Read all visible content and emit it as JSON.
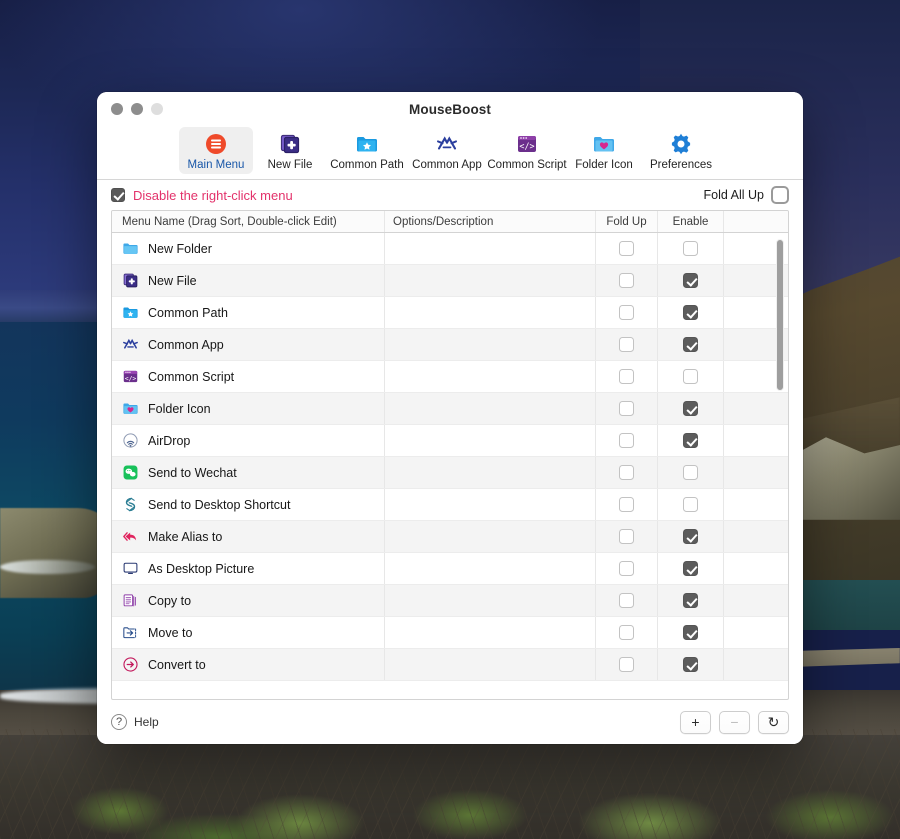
{
  "window": {
    "title": "MouseBoost",
    "traffic_lights": [
      "close-button",
      "minimize-button",
      "zoom-button"
    ]
  },
  "toolbar": {
    "items": [
      {
        "label": "Main Menu",
        "icon": "main-menu-icon",
        "selected": true
      },
      {
        "label": "New File",
        "icon": "new-file-icon",
        "selected": false
      },
      {
        "label": "Common Path",
        "icon": "common-path-icon",
        "selected": false
      },
      {
        "label": "Common App",
        "icon": "common-app-icon",
        "selected": false
      },
      {
        "label": "Common Script",
        "icon": "common-script-icon",
        "selected": false
      },
      {
        "label": "Folder Icon",
        "icon": "folder-icon-icon",
        "selected": false
      },
      {
        "label": "Preferences",
        "icon": "gear-icon",
        "selected": false
      }
    ]
  },
  "options_bar": {
    "disable_label": "Disable the right-click menu",
    "disable_checked": true,
    "disable_color": "#e3326b",
    "fold_all_label": "Fold All Up",
    "fold_all_checked": false
  },
  "table": {
    "headers": {
      "name": "Menu Name (Drag Sort, Double-click Edit)",
      "options": "Options/Description",
      "fold": "Fold Up",
      "enable": "Enable",
      "extra": ""
    },
    "rows": [
      {
        "name": "New Folder",
        "icon": "folder-plain-icon",
        "options": "",
        "fold": false,
        "enable": false
      },
      {
        "name": "New File",
        "icon": "new-file-icon",
        "options": "",
        "fold": false,
        "enable": true
      },
      {
        "name": "Common Path",
        "icon": "common-path-icon",
        "options": "",
        "fold": false,
        "enable": true
      },
      {
        "name": "Common App",
        "icon": "common-app-icon",
        "options": "",
        "fold": false,
        "enable": true
      },
      {
        "name": "Common Script",
        "icon": "common-script-icon",
        "options": "",
        "fold": false,
        "enable": false
      },
      {
        "name": "Folder Icon",
        "icon": "folder-heart-icon",
        "options": "",
        "fold": false,
        "enable": true
      },
      {
        "name": "AirDrop",
        "icon": "airdrop-icon",
        "options": "",
        "fold": false,
        "enable": true
      },
      {
        "name": "Send to Wechat",
        "icon": "wechat-icon",
        "options": "",
        "fold": false,
        "enable": false
      },
      {
        "name": "Send to Desktop Shortcut",
        "icon": "shortcut-icon",
        "options": "",
        "fold": false,
        "enable": false
      },
      {
        "name": "Make Alias to",
        "icon": "alias-arrow-icon",
        "options": "",
        "fold": false,
        "enable": true
      },
      {
        "name": "As Desktop Picture",
        "icon": "display-icon",
        "options": "",
        "fold": false,
        "enable": true
      },
      {
        "name": "Copy to",
        "icon": "copy-icon",
        "options": "",
        "fold": false,
        "enable": true
      },
      {
        "name": "Move to",
        "icon": "move-arrow-icon",
        "options": "",
        "fold": false,
        "enable": true
      },
      {
        "name": "Convert to",
        "icon": "convert-arrow-icon",
        "options": "",
        "fold": false,
        "enable": true
      }
    ]
  },
  "bottom_bar": {
    "help_label": "Help",
    "help_glyph": "?",
    "add_label": "+",
    "remove_label": "−",
    "refresh_label": "↻"
  }
}
